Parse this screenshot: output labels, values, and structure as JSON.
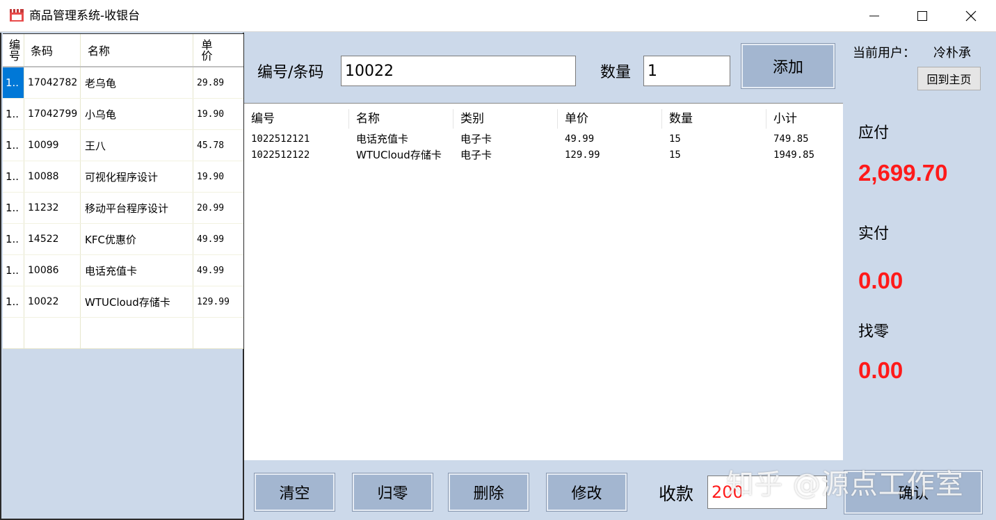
{
  "window": {
    "title": "商品管理系统-收银台"
  },
  "product_table": {
    "headers": [
      "编号",
      "条码",
      "名称",
      "单价"
    ],
    "rows": [
      {
        "id": "1..",
        "barcode": "17042782",
        "name": "老乌龟",
        "price": "29.89"
      },
      {
        "id": "1..",
        "barcode": "17042799",
        "name": "小乌龟",
        "price": "19.90"
      },
      {
        "id": "1..",
        "barcode": "10099",
        "name": "王八",
        "price": "45.78"
      },
      {
        "id": "1..",
        "barcode": "10088",
        "name": "可视化程序设计",
        "price": "19.90"
      },
      {
        "id": "1..",
        "barcode": "11232",
        "name": "移动平台程序设计",
        "price": "20.99"
      },
      {
        "id": "1..",
        "barcode": "14522",
        "name": "KFC优惠价",
        "price": "49.99"
      },
      {
        "id": "1..",
        "barcode": "10086",
        "name": "电话充值卡",
        "price": "49.99"
      },
      {
        "id": "1..",
        "barcode": "10022",
        "name": "WTUCloud存储卡",
        "price": "129.99"
      }
    ]
  },
  "input": {
    "code_label": "编号/条码",
    "code_value": "10022",
    "qty_label": "数量",
    "qty_value": "1",
    "add_label": "添加"
  },
  "cart": {
    "headers": [
      "编号",
      "名称",
      "类别",
      "单价",
      "数量",
      "小计"
    ],
    "rows": [
      {
        "id": "1022512121",
        "name": "电话充值卡",
        "category": "电子卡",
        "price": "49.99",
        "qty": "15",
        "subtotal": "749.85"
      },
      {
        "id": "1022512122",
        "name": "WTUCloud存储卡",
        "category": "电子卡",
        "price": "129.99",
        "qty": "15",
        "subtotal": "1949.85"
      }
    ]
  },
  "summary": {
    "user_label": "当前用户：",
    "user_name": "冷朴承",
    "home_label": "回到主页",
    "due_label": "应付",
    "due_value": "2,699.70",
    "paid_label": "实付",
    "paid_value": "0.00",
    "change_label": "找零",
    "change_value": "0.00"
  },
  "bottom": {
    "clear_label": "清空",
    "zero_label": "归零",
    "delete_label": "删除",
    "edit_label": "修改",
    "receive_label": "收款",
    "receive_value": "200",
    "confirm_label": "确认"
  },
  "watermark": "知乎 @源点工作室",
  "colors": {
    "panel_bg": "#ccd9ea",
    "button_bg": "#a3b6d0",
    "amount_red": "#ff1a1a",
    "selection_blue": "#0078d7"
  }
}
